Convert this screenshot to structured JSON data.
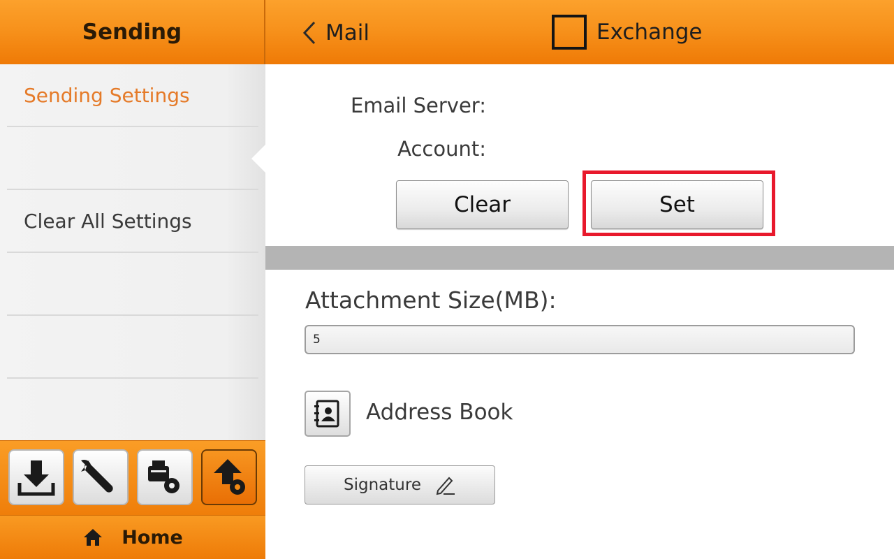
{
  "header": {
    "section_title": "Sending",
    "back_label": "Mail",
    "exchange_label": "Exchange",
    "exchange_checked": false
  },
  "sidebar": {
    "items": [
      {
        "label": "Sending Settings",
        "active": true
      },
      {
        "label": ""
      },
      {
        "label": "Clear All Settings"
      },
      {
        "label": ""
      },
      {
        "label": ""
      }
    ]
  },
  "toolbar": {
    "tools": [
      {
        "icon": "download-tray-icon"
      },
      {
        "icon": "wrench-icon"
      },
      {
        "icon": "scanner-settings-icon"
      },
      {
        "icon": "upload-settings-icon",
        "selected": true
      }
    ],
    "home_label": "Home"
  },
  "main": {
    "email_server_label": "Email Server:",
    "account_label": "Account:",
    "clear_label": "Clear",
    "set_label": "Set",
    "attachment_label": "Attachment Size(MB):",
    "attachment_value": "5",
    "address_book_label": "Address Book",
    "signature_label": "Signature"
  },
  "colors": {
    "accent_orange": "#f7921c",
    "active_text": "#e57a28",
    "highlight_red": "#e8192c"
  }
}
